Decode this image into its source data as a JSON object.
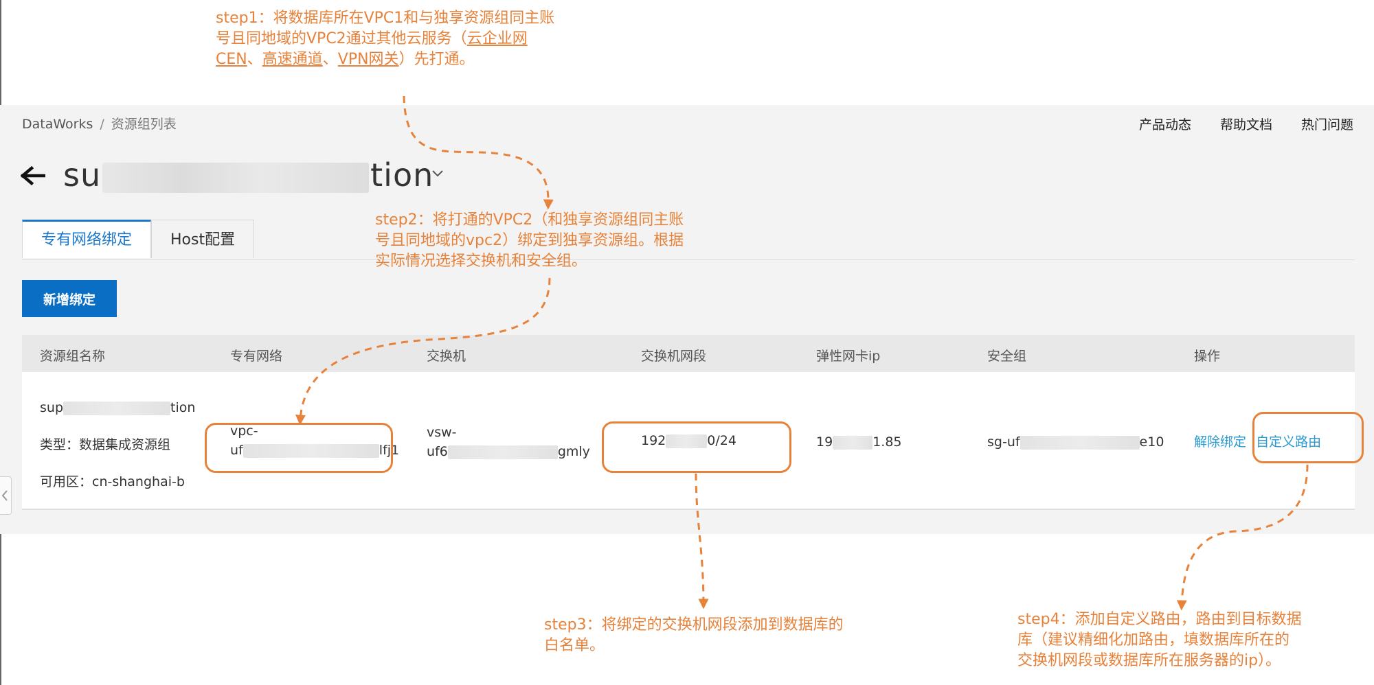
{
  "breadcrumb": {
    "root": "DataWorks",
    "separator": "/",
    "current": "资源组列表"
  },
  "top_links": {
    "product_news": "产品动态",
    "help_docs": "帮助文档",
    "faq": "热门问题"
  },
  "page_title": {
    "prefix": "su",
    "suffix": "tion"
  },
  "tabs": [
    {
      "label": "专有网络绑定",
      "active": true
    },
    {
      "label": "Host配置",
      "active": false
    }
  ],
  "add_button": "新增绑定",
  "table": {
    "headers": [
      "资源组名称",
      "专有网络",
      "交换机",
      "交换机网段",
      "弹性网卡ip",
      "安全组",
      "操作"
    ],
    "row": {
      "name_prefix": "sup",
      "name_suffix": "tion",
      "type_text": "类型：数据集成资源组",
      "zone_text": "可用区：cn-shanghai-b",
      "vpc_line1": "vpc-",
      "vpc_prefix": "uf",
      "vpc_suffix": "lfj1",
      "vsw_line1": "vsw-",
      "vsw_prefix": "uf6",
      "vsw_suffix": "gmly",
      "cidr_prefix": "192",
      "cidr_suffix": "0/24",
      "eni_prefix": "19",
      "eni_suffix": "1.85",
      "sg_prefix": "sg-uf",
      "sg_suffix": "e10",
      "action_unbind": "解除绑定",
      "action_route": "自定义路由"
    }
  },
  "notes": {
    "step1_a": "step1：将数据库所在VPC1和与独享资源组同主账",
    "step1_b": "号且同地域的VPC2通过其他云服务（",
    "step1_link_cen_1": "云企业网",
    "step1_link_cen_2": "CEN",
    "step1_sep1": "、",
    "step1_link_express": "高速通道",
    "step1_sep2": "、",
    "step1_link_vpn": "VPN网关",
    "step1_end": "）先打通。",
    "step2_a": "step2：将打通的VPC2（和独享资源组同主账",
    "step2_b": "号且同地域的vpc2）绑定到独享资源组。根据",
    "step2_c": "实际情况选择交换机和安全组。",
    "step3_a": "step3：将绑定的交换机网段添加到数据库的",
    "step3_b": "白名单。",
    "step4_a": "step4：添加自定义路由，路由到目标数据",
    "step4_b": "库（建议精细化加路由，填数据库所在的",
    "step4_c": "交换机网段或数据库所在服务器的ip）。"
  },
  "colors": {
    "annotation": "#e7823a",
    "primary": "#0b6ec5",
    "tab_active": "#1a77c9",
    "link": "#2a9ad0"
  },
  "icons": [
    "back-arrow-icon",
    "chevron-down-icon",
    "collapse-left-icon"
  ]
}
